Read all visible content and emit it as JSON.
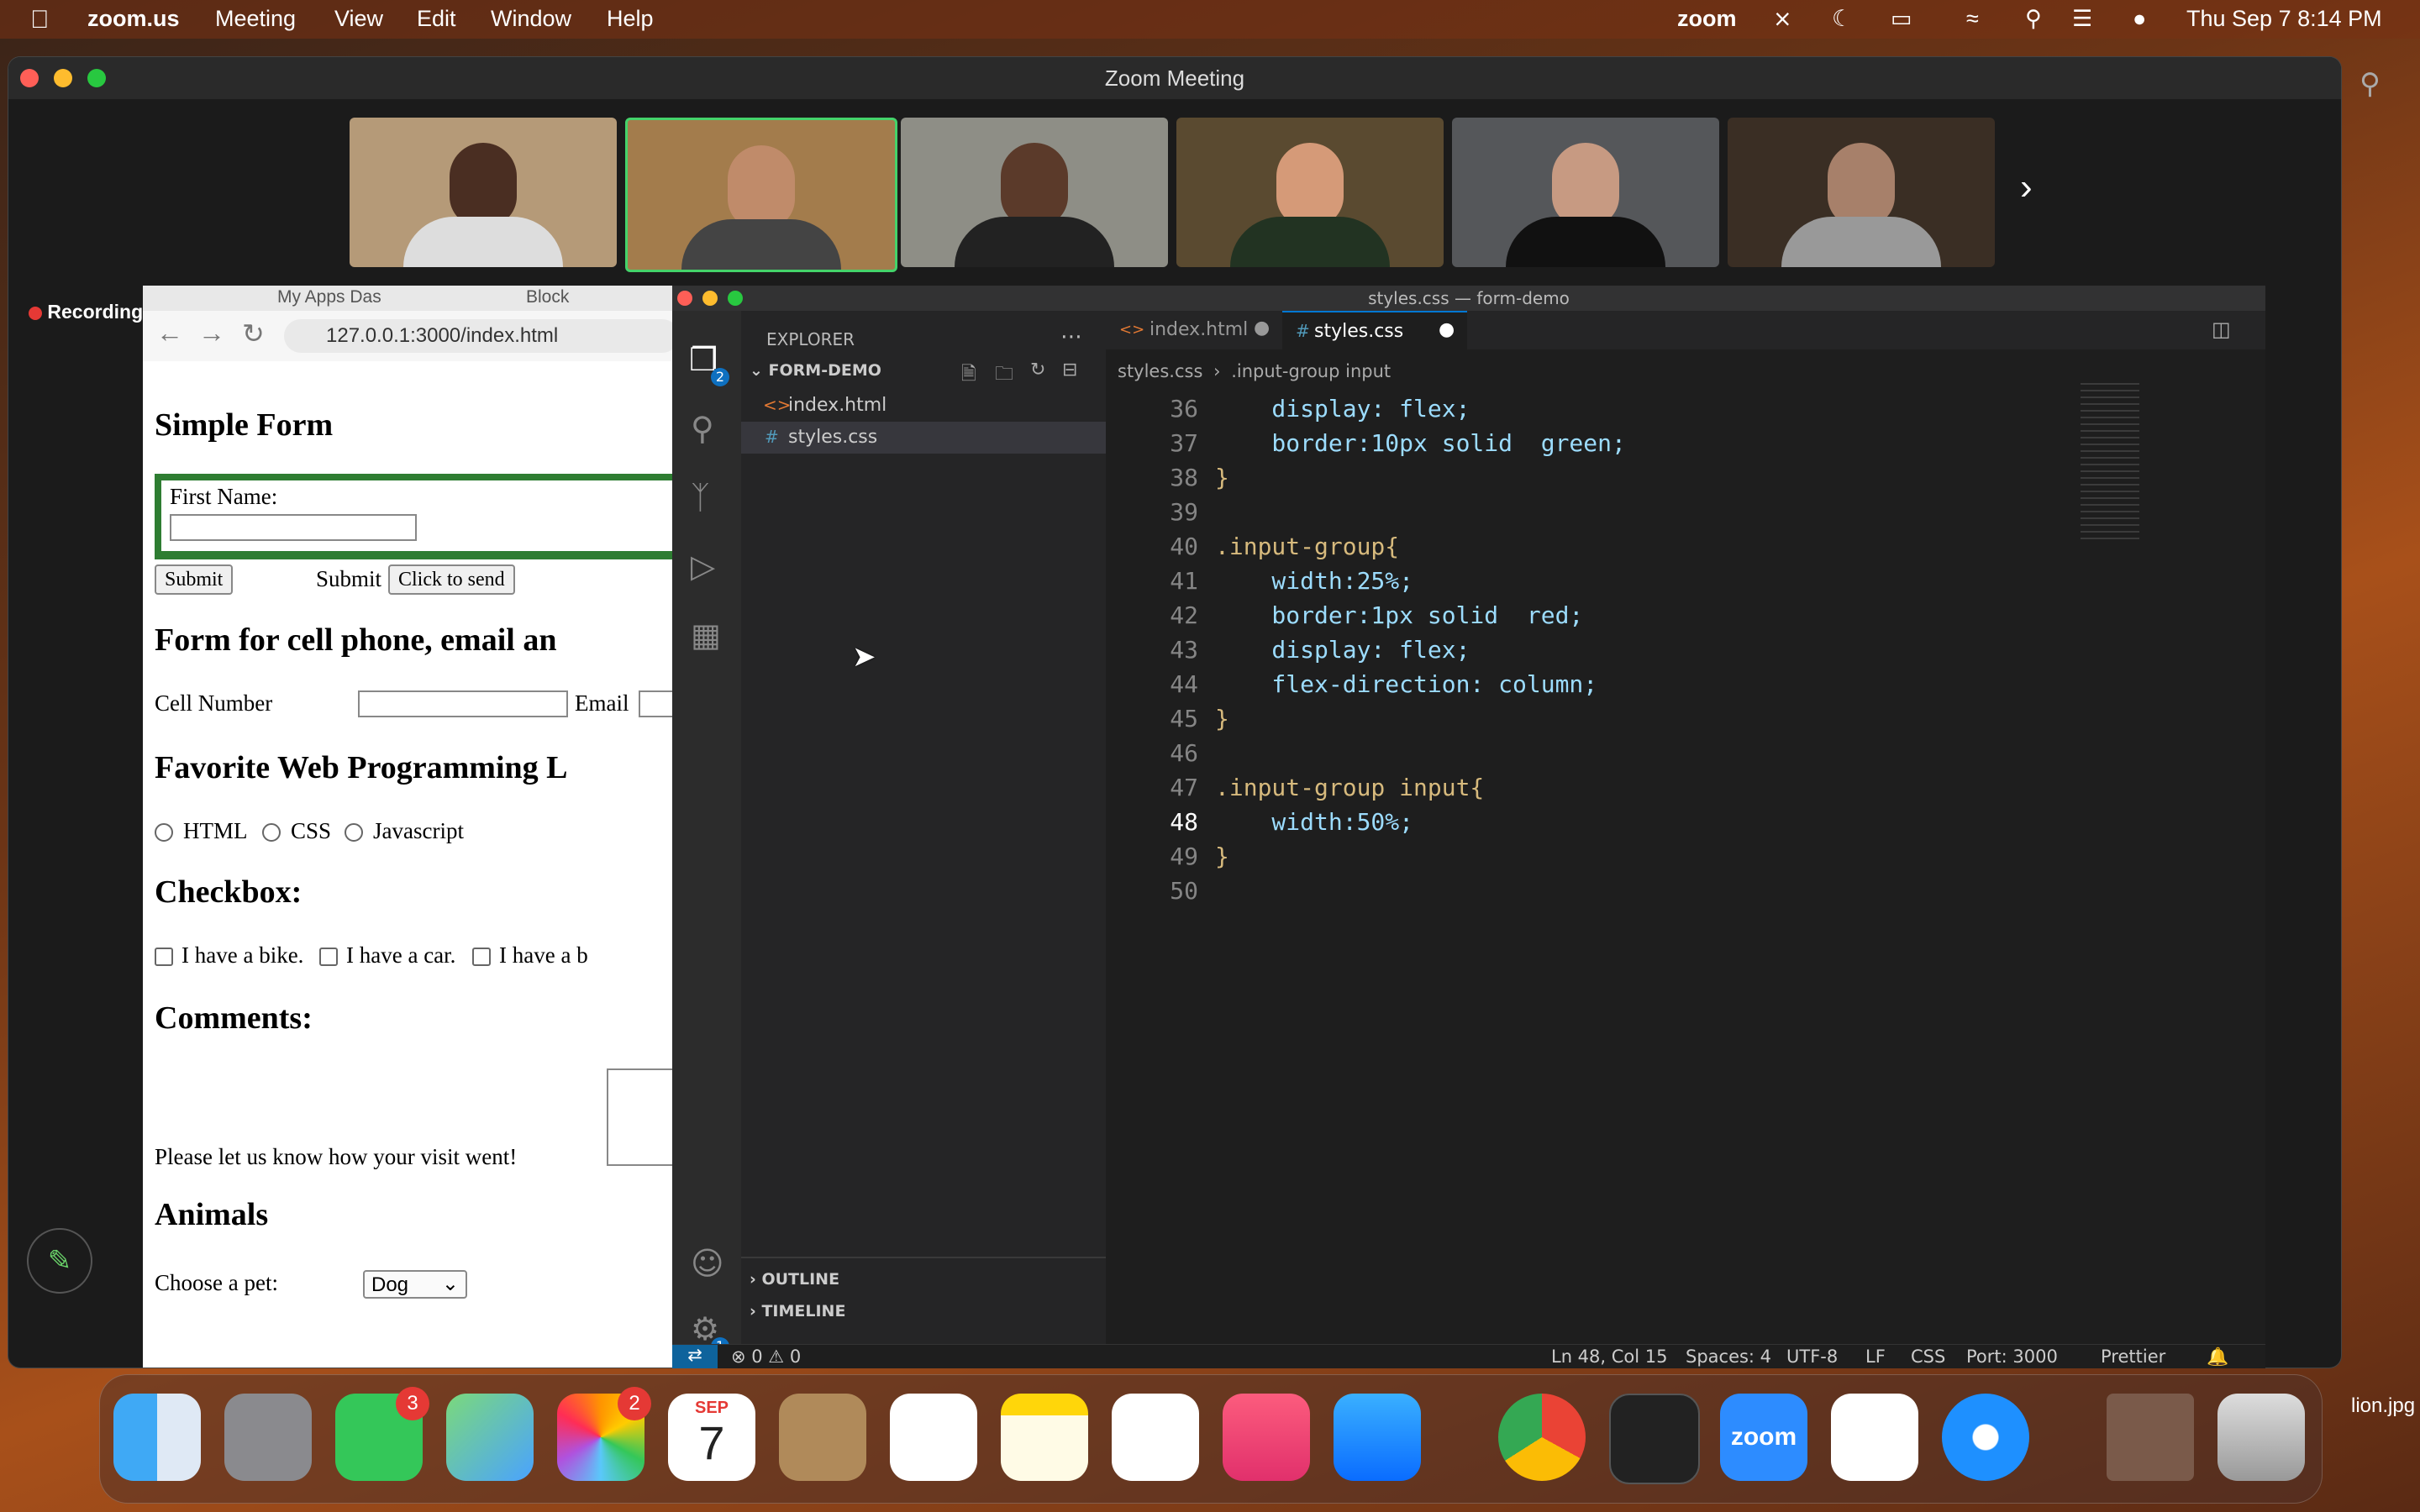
{
  "menubar": {
    "app": "zoom.us",
    "items": [
      "Meeting",
      "View",
      "Edit",
      "Window",
      "Help"
    ],
    "zoom_label": "zoom",
    "datetime": "Thu Sep 7  8:14 PM"
  },
  "zoom_window": {
    "title": "Zoom Meeting",
    "recording_label": "Recording"
  },
  "browser": {
    "tab1": "My Apps Das",
    "tab2": "Block",
    "url": "127.0.0.1:3000/index.html",
    "h_simple_form": "Simple Form",
    "first_name_label": "First Name:",
    "submit_btn": "Submit",
    "submit_text": "Submit",
    "click_to_send_btn": "Click to send",
    "h_cell_form": "Form for cell phone, email an",
    "cell_label": "Cell Number",
    "email_label": "Email",
    "h_fav_lang": "Favorite Web Programming L",
    "radio_options": [
      "HTML",
      "CSS",
      "Javascript"
    ],
    "h_checkbox": "Checkbox:",
    "checkbox_options": [
      "I have a bike.",
      "I have a car.",
      "I have a b"
    ],
    "h_comments": "Comments:",
    "comments_label": "Please let us know how your visit went!",
    "h_animals": "Animals",
    "pet_label": "Choose a pet:",
    "pet_value": "Dog"
  },
  "vscode": {
    "window_title": "styles.css — form-demo",
    "explorer_title": "EXPLORER",
    "project": "FORM-DEMO",
    "files": [
      "index.html",
      "styles.css"
    ],
    "tabs": [
      "index.html",
      "styles.css"
    ],
    "breadcrumb_file": "styles.css",
    "breadcrumb_selector": ".input-group input",
    "outline": "OUTLINE",
    "timeline": "TIMELINE",
    "code_lines": [
      {
        "n": "36",
        "text": "    display: flex;"
      },
      {
        "n": "37",
        "text": "    border:10px solid  green;"
      },
      {
        "n": "38",
        "text": "}"
      },
      {
        "n": "39",
        "text": ""
      },
      {
        "n": "40",
        "text": ".input-group{"
      },
      {
        "n": "41",
        "text": "    width:25%;"
      },
      {
        "n": "42",
        "text": "    border:1px solid  red;"
      },
      {
        "n": "43",
        "text": "    display: flex;"
      },
      {
        "n": "44",
        "text": "    flex-direction: column;"
      },
      {
        "n": "45",
        "text": "}"
      },
      {
        "n": "46",
        "text": ""
      },
      {
        "n": "47",
        "text": ".input-group input{"
      },
      {
        "n": "48",
        "text": "    width:50%;"
      },
      {
        "n": "49",
        "text": "}"
      },
      {
        "n": "50",
        "text": ""
      }
    ],
    "status": {
      "errors": "0",
      "warnings": "0",
      "position": "Ln 48, Col 15",
      "spaces": "Spaces: 4",
      "encoding": "UTF-8",
      "eol": "LF",
      "language": "CSS",
      "port": "Port: 3000",
      "prettier": "Prettier"
    },
    "explorer_badge": "2",
    "settings_badge": "1"
  },
  "dock": {
    "messages_badge": "3",
    "photos_badge": "2",
    "calendar_month": "SEP",
    "calendar_day": "7",
    "zoom_label": "zoom",
    "desktop_file": "lion.jpg"
  }
}
